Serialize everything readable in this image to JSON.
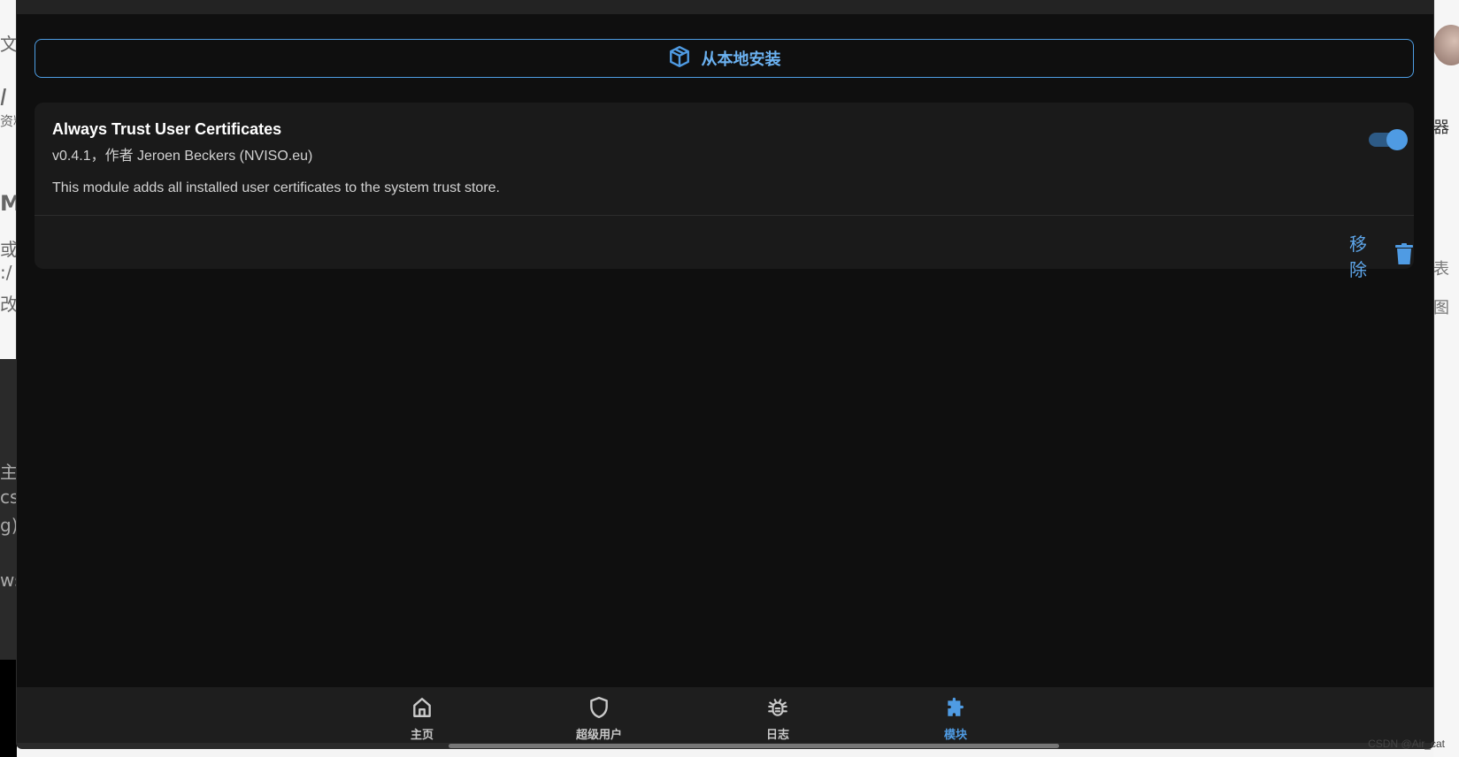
{
  "background_fragments": {
    "left": [
      "文章",
      "I",
      "资料",
      "M",
      "或",
      ":/",
      "改",
      "主",
      "cs",
      "g)",
      "ws"
    ],
    "right": [
      "器",
      "表",
      "图"
    ]
  },
  "install_button": {
    "label": "从本地安装",
    "icon": "package-icon"
  },
  "module": {
    "title": "Always Trust User Certificates",
    "meta": "v0.4.1，作者 Jeroen Beckers (NVISO.eu)",
    "description": "This module adds all installed user certificates to the system trust store.",
    "enabled": true,
    "remove_label": "移除"
  },
  "nav": [
    {
      "label": "主页",
      "icon": "home-icon",
      "active": false
    },
    {
      "label": "超级用户",
      "icon": "shield-icon",
      "active": false
    },
    {
      "label": "日志",
      "icon": "bug-icon",
      "active": false
    },
    {
      "label": "模块",
      "icon": "puzzle-icon",
      "active": true
    }
  ],
  "colors": {
    "accent": "#4f9be3",
    "background": "#0f0f0f",
    "card": "#1a1a1a"
  },
  "watermark": "CSDN @Air_cat"
}
